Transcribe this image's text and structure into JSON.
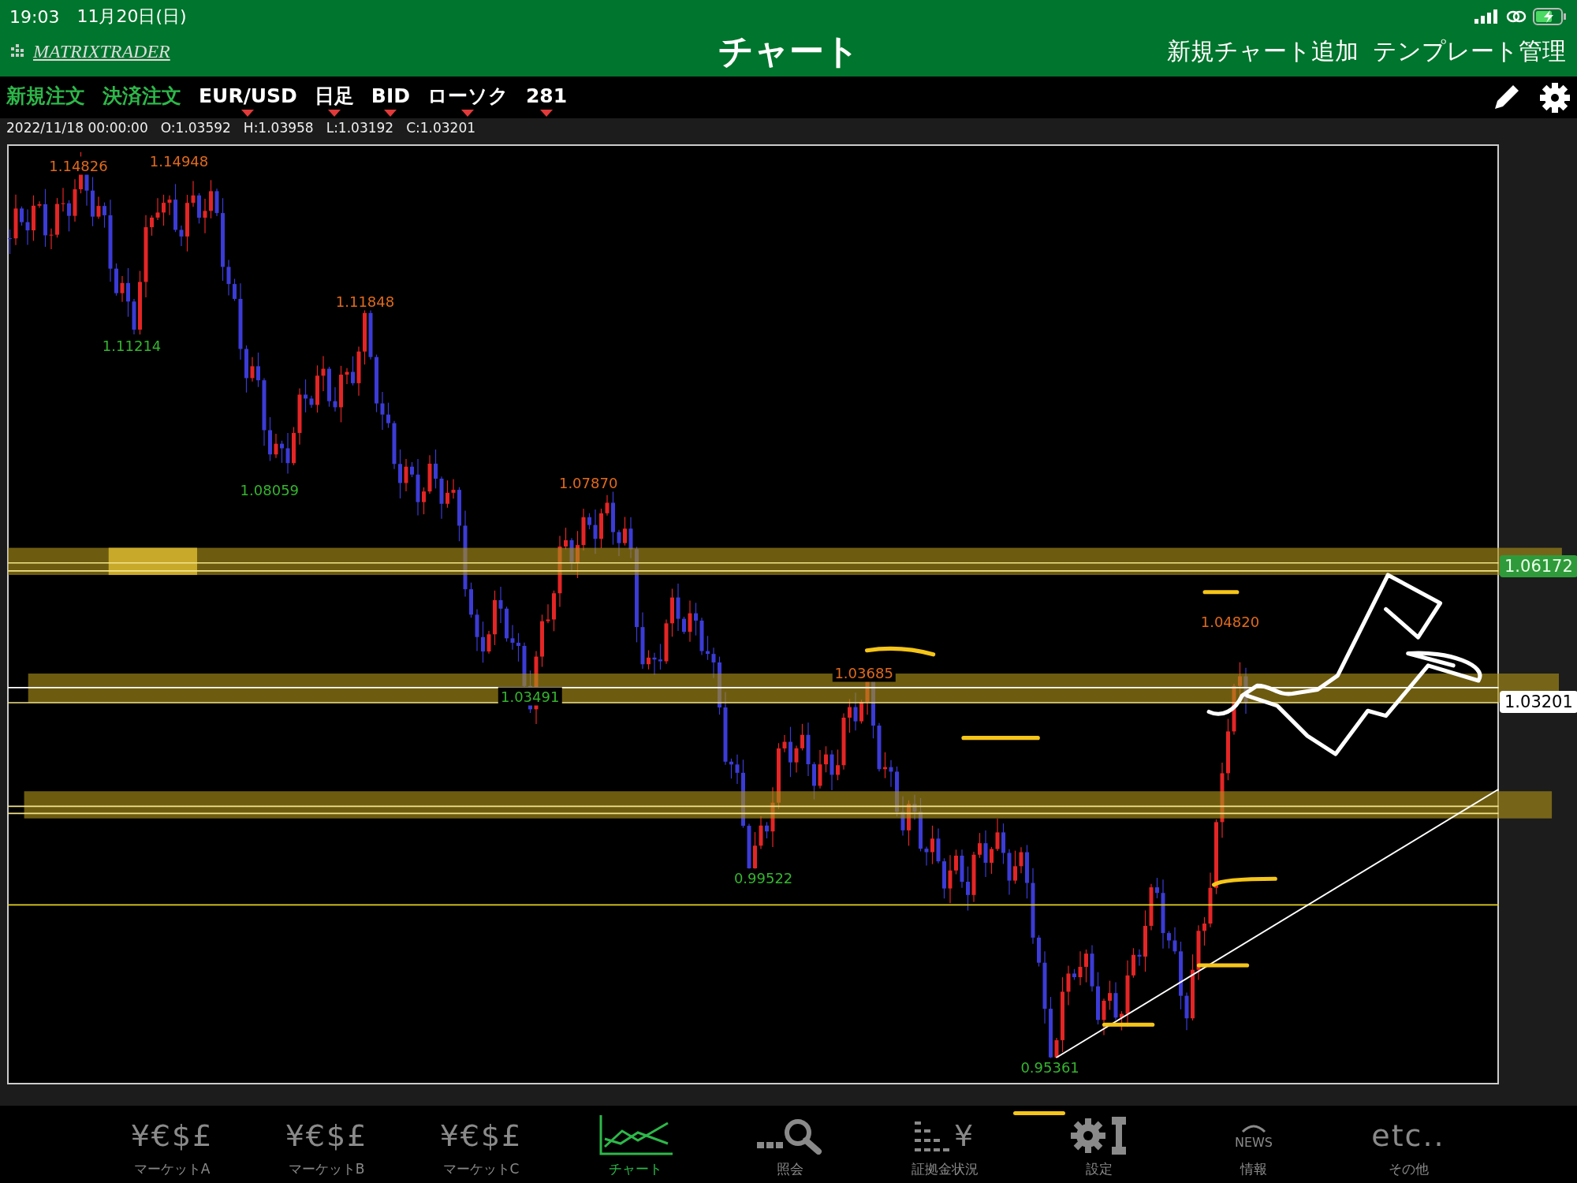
{
  "status_bar": {
    "time": "19:03",
    "date": "11月20日(日)"
  },
  "header": {
    "logo": "MATRIXTRADER",
    "title": "チャート",
    "actions": [
      "新規チャート追加",
      "テンプレート管理"
    ]
  },
  "toolbar": {
    "items": [
      {
        "label": "新規注文",
        "kind": "action"
      },
      {
        "label": "決済注文",
        "kind": "action"
      },
      {
        "label": "EUR/USD",
        "kind": "dropdown"
      },
      {
        "label": "日足",
        "kind": "dropdown"
      },
      {
        "label": "BID",
        "kind": "dropdown"
      },
      {
        "label": "ローソク",
        "kind": "dropdown"
      },
      {
        "label": "281",
        "kind": "dropdown"
      }
    ]
  },
  "ohlc_info": [
    "2022/11/18 00:00:00",
    "O:1.03592",
    "H:1.03958",
    "L:1.03192",
    "C:1.03201"
  ],
  "chart": {
    "extreme_labels": [
      {
        "text": "1.14826",
        "kind": "high"
      },
      {
        "text": "1.14948",
        "kind": "high"
      },
      {
        "text": "1.11214",
        "kind": "low"
      },
      {
        "text": "1.11848",
        "kind": "high"
      },
      {
        "text": "1.08059",
        "kind": "low"
      },
      {
        "text": "1.07870",
        "kind": "high"
      },
      {
        "text": "1.03491",
        "kind": "low"
      },
      {
        "text": "1.03685",
        "kind": "high"
      },
      {
        "text": "0.99522",
        "kind": "low"
      },
      {
        "text": "1.04820",
        "kind": "high"
      },
      {
        "text": "0.95361",
        "kind": "low"
      }
    ],
    "price_tags": [
      {
        "text": "1.06172",
        "kind": "line"
      },
      {
        "text": "1.03201",
        "kind": "current"
      }
    ]
  },
  "tab_bar": {
    "items": [
      {
        "label": "マーケットA",
        "glyph": "¥€$£",
        "selected": false
      },
      {
        "label": "マーケットB",
        "glyph": "¥€$£",
        "selected": false
      },
      {
        "label": "マーケットC",
        "glyph": "¥€$£",
        "selected": false
      },
      {
        "label": "チャート",
        "selected": true
      },
      {
        "label": "照会",
        "selected": false
      },
      {
        "label": "証拠金状況",
        "glyph": "¥",
        "selected": false
      },
      {
        "label": "設定",
        "selected": false
      },
      {
        "label": "情報",
        "glyph": "NEWS",
        "selected": false
      },
      {
        "label": "その他",
        "glyph": "etc..",
        "selected": false
      }
    ]
  }
}
